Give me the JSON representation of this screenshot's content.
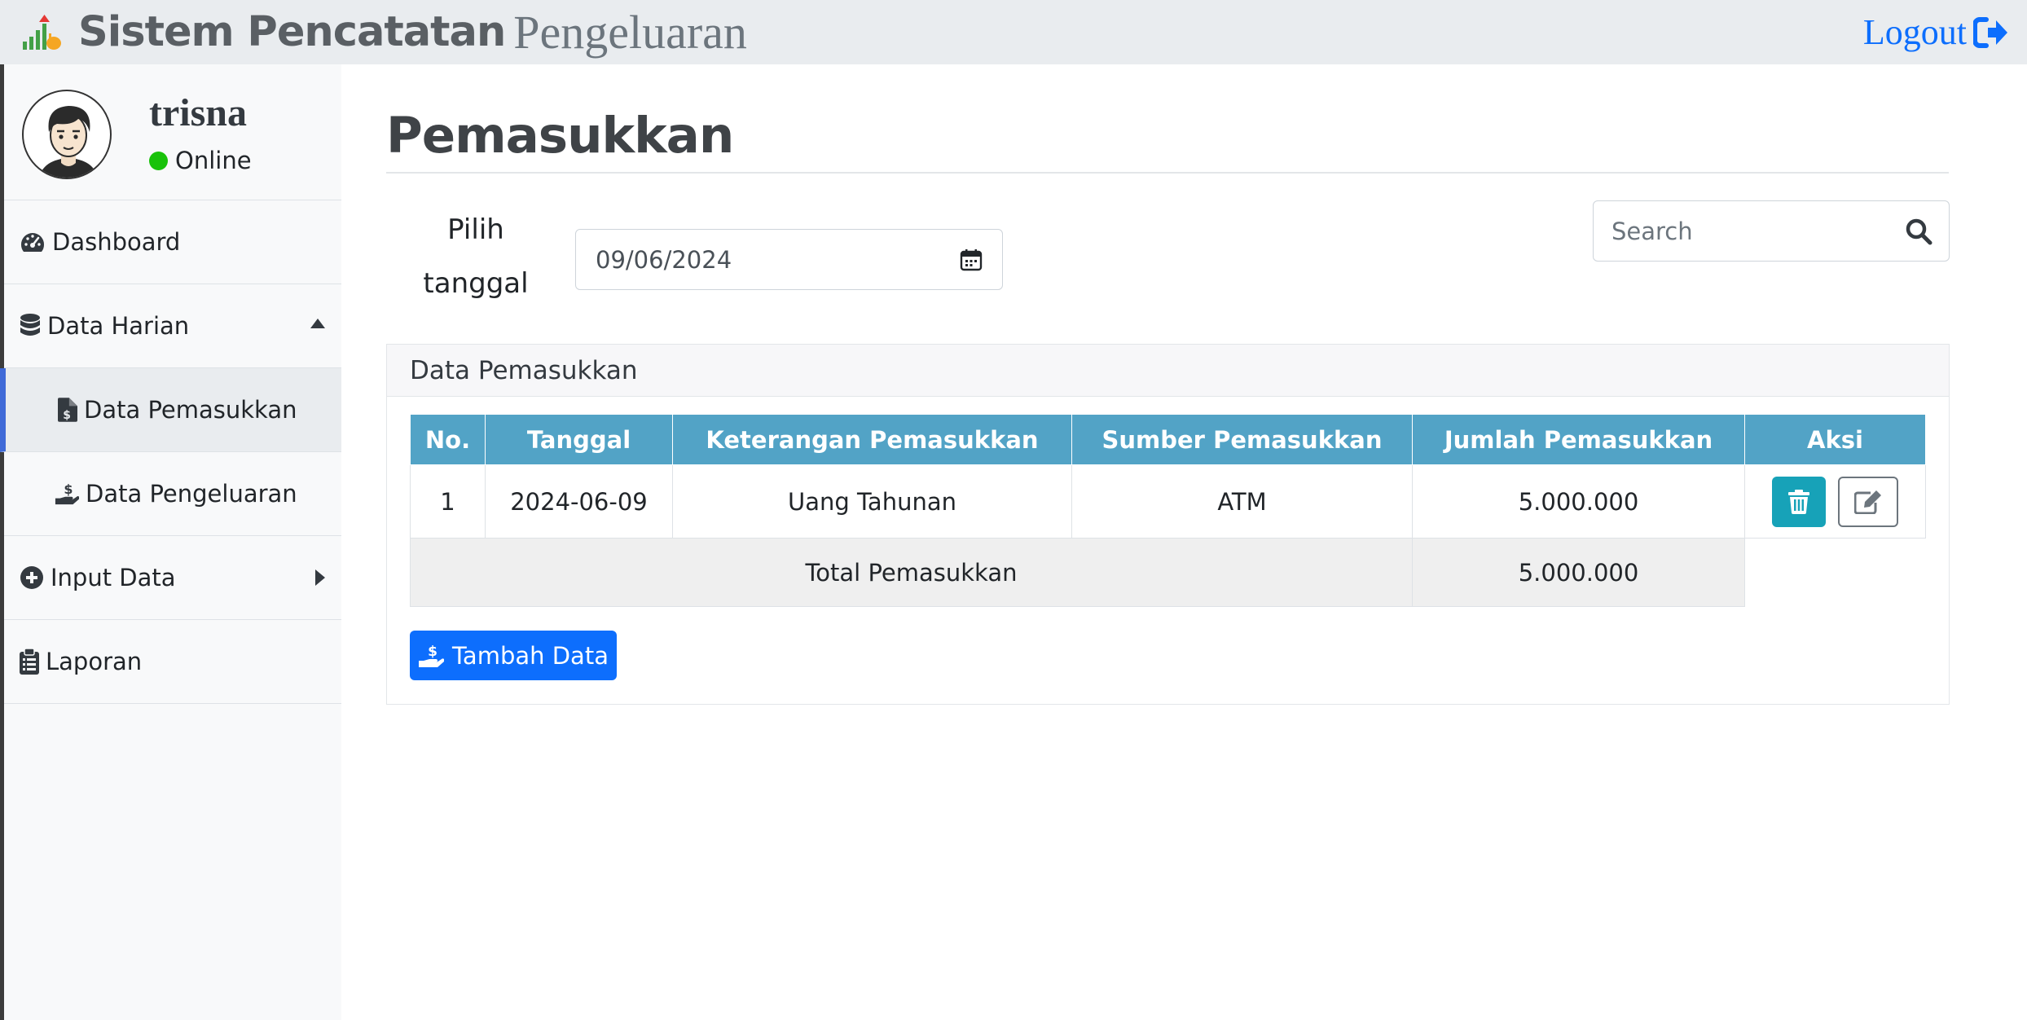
{
  "header": {
    "title_bold": "Sistem Pencatatan",
    "title_light": "Pengeluaran",
    "logout_label": "Logout"
  },
  "sidebar": {
    "user": {
      "name": "trisna",
      "status": "Online"
    },
    "items": [
      {
        "label": "Dashboard",
        "icon": "tachometer-icon"
      },
      {
        "label": "Data Harian",
        "icon": "database-icon"
      },
      {
        "label": "Data Pemasukkan",
        "icon": "file-invoice-dollar-icon"
      },
      {
        "label": "Data Pengeluaran",
        "icon": "hand-holding-dollar-icon"
      },
      {
        "label": "Input Data",
        "icon": "plus-circle-icon"
      },
      {
        "label": "Laporan",
        "icon": "clipboard-list-icon"
      }
    ]
  },
  "main": {
    "title": "Pemasukkan",
    "date_label": "Pilih tanggal",
    "date_value": "09/06/2024",
    "search_placeholder": "Search",
    "card_title": "Data Pemasukkan",
    "table": {
      "headers": [
        "No.",
        "Tanggal",
        "Keterangan Pemasukkan",
        "Sumber Pemasukkan",
        "Jumlah Pemasukkan",
        "Aksi"
      ],
      "rows": [
        {
          "no": "1",
          "tanggal": "2024-06-09",
          "keterangan": "Uang Tahunan",
          "sumber": "ATM",
          "jumlah": "5.000.000"
        }
      ],
      "total_label": "Total Pemasukkan",
      "total_value": "5.000.000"
    },
    "add_button": "Tambah Data"
  },
  "colors": {
    "accent": "#0d6efd",
    "table_header": "#52a3c6",
    "delete_button": "#17a2b8",
    "status_online": "#19c20a",
    "active_nav_border": "#3f6ad8"
  }
}
